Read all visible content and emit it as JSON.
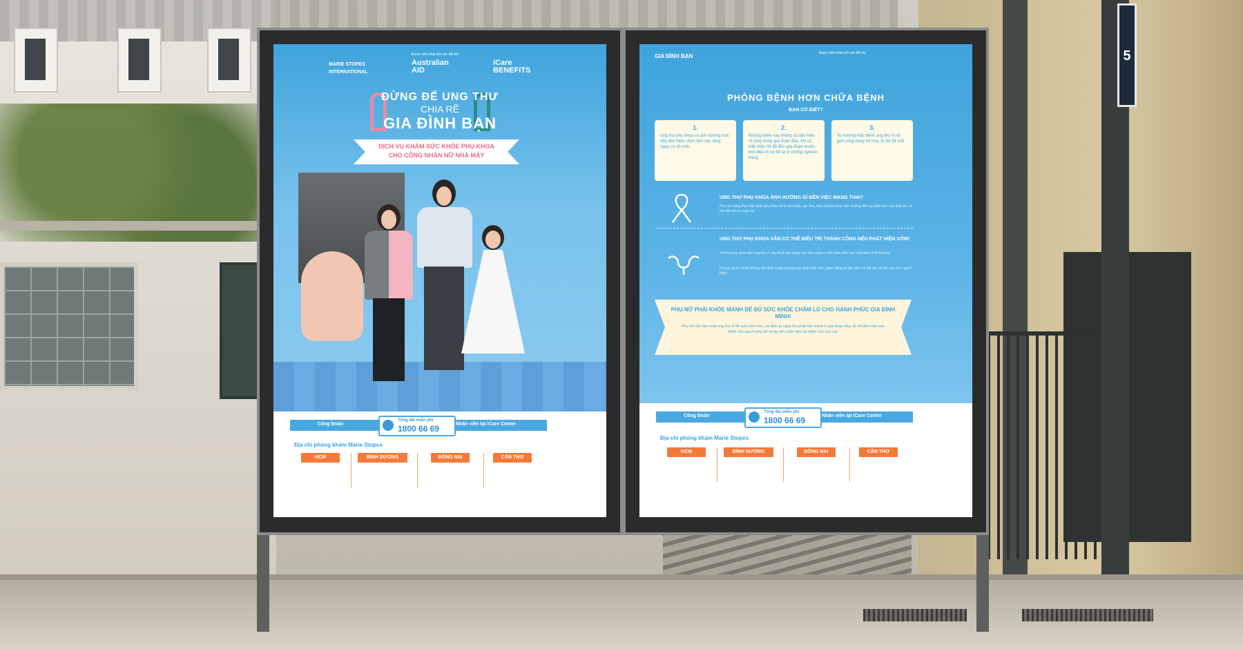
{
  "left_poster": {
    "partner_note": "Được triển khai bởi các đối tác",
    "logos": [
      "MARIE STOPES INTERNATIONAL",
      "Australian AID",
      "iCare BENEFITS"
    ],
    "headline_1": "ĐỪNG ĐỂ UNG THƯ",
    "headline_2": "CHIA RẼ",
    "headline_3": "GIA ĐÌNH BẠN",
    "banner_line_1": "DỊCH VỤ KHÁM SỨC KHỎE PHỤ KHOA",
    "banner_line_2": "CHO CÔNG NHÂN NỮ NHÀ MÁY"
  },
  "right_poster": {
    "title": "PHÒNG BỆNH HƠN CHỮA BỆNH",
    "subtitle": "BẠN CÓ BIẾT?",
    "facts": [
      {
        "num": "1.",
        "text": "Ung thư phụ khoa có ảnh hưởng trực tiếp đến thiên chức làm mẹ, tăng nguy cơ vô sinh."
      },
      {
        "num": "2.",
        "text": "Những bệnh này không có dấu hiệu rõ ràng trong giai đoạn đầu, khi có biểu hiện thì đã đến giai đoạn muộn, khó điều trị và để lại di chứng nghiêm trọng."
      },
      {
        "num": "3.",
        "text": "Xu hướng mắc bệnh ung thư ở nữ giới cũng đang trẻ hóa, từ 30-34 tuổi."
      }
    ],
    "q1_title": "UNG THƯ PHỤ KHOA ẢNH HƯỞNG GÌ ĐẾN VIỆC MANG THAI?",
    "q1_body": "Phụ nữ mang thai mắc bệnh phụ khoa dễ bị sinh khó, sảy thai, thai chết lưu thai, ảnh hưởng đến sự phát triển của thai nhi, có thể dẫn tới tử vong mẹ.",
    "q2_title": "UNG THƯ PHỤ KHOA VẪN CÓ THỂ ĐIỀU TRỊ THÀNH CÔNG NẾU PHÁT HIỆN SỚM!",
    "q2_body_1": "Trường hợp phát hiện ung thư ở cấp độ tế bào bằng việc tầm soát có thể chữa khỏi như một bệnh bình thường.",
    "q2_body_2": "Hóa trị, xạ trị có thể không cần thiết trong trường hợp phát hiện sớm, giảm đáng kể đau đớn về thể xác và tiền bạc cho người bệnh.",
    "callout_title": "PHỤ NỮ PHẢI KHỎE MẠNH ĐỂ ĐỦ SỨC KHỎE CHĂM LO CHO HẠNH PHÚC GIA ĐÌNH MÌNH!",
    "callout_body": "Phụ nữ cần tầm soát ung thư ở độ tuổi sớm hơn, và điều trị ngay khi phát hiện bệnh ở giai đoạn đầu; từ đó đảm bảo sức khỏe cho người phụ nữ trong việc kiếm tiền và chăm sóc con cái."
  },
  "footer": {
    "left_label": "Công Đoàn",
    "hotline_label": "Tổng đài miễn phí",
    "hotline_number": "1800 66 69",
    "right_label": "Nhân viên tại iCare Center",
    "address_title": "Địa chỉ phòng khám Marie Stopes",
    "cities": [
      "HCM",
      "BÌNH DƯƠNG",
      "ĐỒNG NAI",
      "CẦN THƠ"
    ]
  },
  "sign_number": "5"
}
